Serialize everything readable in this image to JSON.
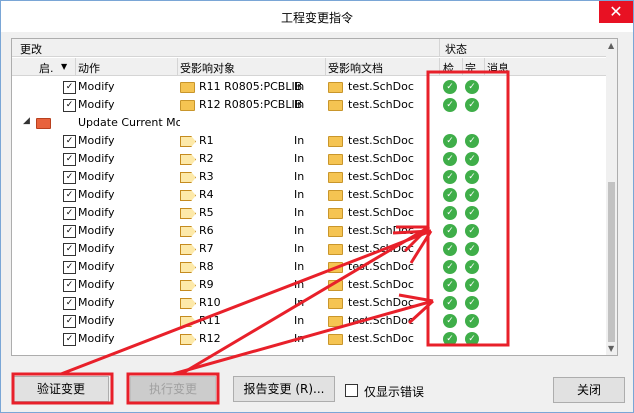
{
  "window": {
    "title": "工程变更指令",
    "close_glyph": "✕"
  },
  "grid": {
    "group_header_left": "更改",
    "group_header_right": "状态",
    "columns": {
      "enable": "启.",
      "sort_glyph": "▼",
      "action": "动作",
      "object": "受影响对象",
      "document": "受影响文档",
      "check": "检.",
      "done": "完.",
      "message": "消息"
    },
    "rows_top": [
      {
        "action": "Modify",
        "object": "R11 R0805:PCBLIB",
        "in": "In",
        "doc": "test.SchDoc"
      },
      {
        "action": "Modify",
        "object": "R12 R0805:PCBLIB",
        "in": "In",
        "doc": "test.SchDoc"
      }
    ],
    "group": {
      "expand": "◢",
      "label": "Update Current Mo"
    },
    "rows": [
      {
        "action": "Modify",
        "object": "R1",
        "in": "In",
        "doc": "test.SchDoc"
      },
      {
        "action": "Modify",
        "object": "R2",
        "in": "In",
        "doc": "test.SchDoc"
      },
      {
        "action": "Modify",
        "object": "R3",
        "in": "In",
        "doc": "test.SchDoc"
      },
      {
        "action": "Modify",
        "object": "R4",
        "in": "In",
        "doc": "test.SchDoc"
      },
      {
        "action": "Modify",
        "object": "R5",
        "in": "In",
        "doc": "test.SchDoc"
      },
      {
        "action": "Modify",
        "object": "R6",
        "in": "In",
        "doc": "test.SchDoc"
      },
      {
        "action": "Modify",
        "object": "R7",
        "in": "In",
        "doc": "test.SchDoc"
      },
      {
        "action": "Modify",
        "object": "R8",
        "in": "In",
        "doc": "test.SchDoc"
      },
      {
        "action": "Modify",
        "object": "R9",
        "in": "In",
        "doc": "test.SchDoc"
      },
      {
        "action": "Modify",
        "object": "R10",
        "in": "In",
        "doc": "test.SchDoc"
      },
      {
        "action": "Modify",
        "object": "R11",
        "in": "In",
        "doc": "test.SchDoc"
      },
      {
        "action": "Modify",
        "object": "R12",
        "in": "In",
        "doc": "test.SchDoc"
      }
    ],
    "check_glyph": "✓"
  },
  "buttons": {
    "validate": "验证变更",
    "execute": "执行变更",
    "report": "报告变更 (R)...",
    "only_errors": "仅显示错误",
    "close": "关闭"
  },
  "colors": {
    "annotation_red": "#e8202a",
    "ok_green": "#3fae49"
  }
}
